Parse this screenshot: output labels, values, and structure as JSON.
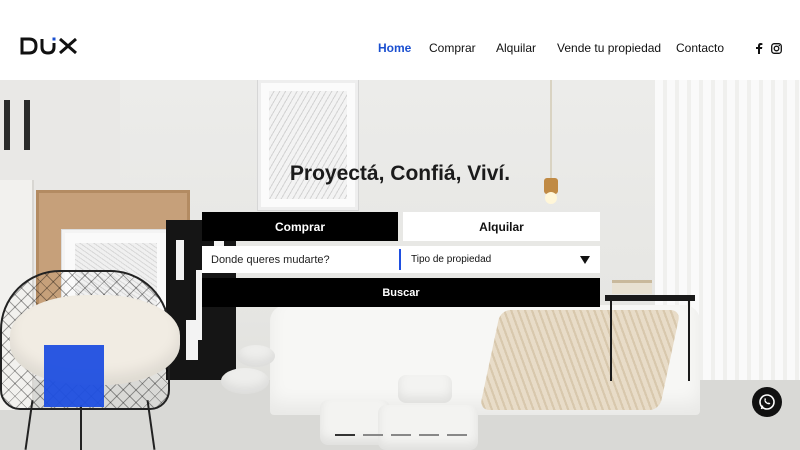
{
  "header": {
    "logo_text": "DUX",
    "nav": [
      {
        "label": "Home",
        "active": true
      },
      {
        "label": "Comprar",
        "active": false
      },
      {
        "label": "Alquilar",
        "active": false
      },
      {
        "label": "Vende tu propiedad",
        "active": false
      },
      {
        "label": "Contacto",
        "active": false
      }
    ],
    "social_icons": [
      "facebook-icon",
      "instagram-icon"
    ]
  },
  "hero": {
    "title": "Proyectá, Confiá, Viví.",
    "tabs": [
      {
        "label": "Comprar",
        "selected": true
      },
      {
        "label": "Alquilar",
        "selected": false
      }
    ],
    "search_placeholder": "Donde queres mudarte?",
    "property_type_label": "Tipo de propiedad",
    "search_button": "Buscar",
    "slide_count": 5,
    "active_slide": 1
  },
  "colors": {
    "accent": "#1a4fd0",
    "primary_button": "#000000"
  },
  "floating": {
    "whatsapp_icon": "whatsapp-icon"
  }
}
